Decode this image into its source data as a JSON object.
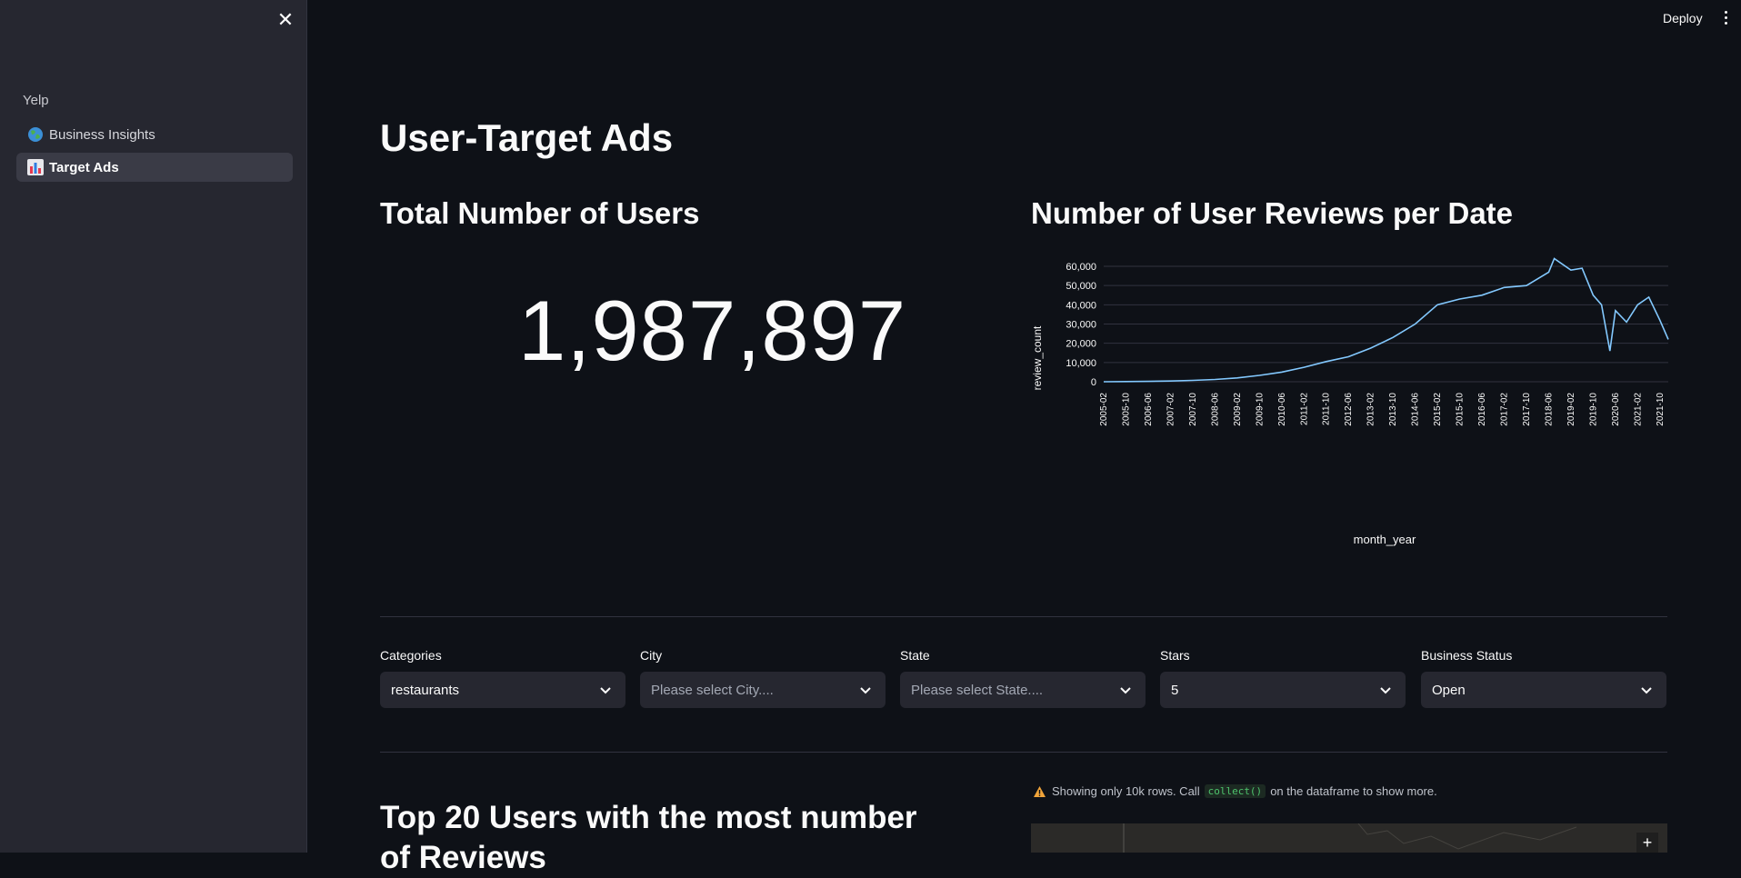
{
  "sidebar": {
    "section_title": "Yelp",
    "items": [
      {
        "label": "Business Insights",
        "icon": "globe-icon",
        "active": false
      },
      {
        "label": "Target Ads",
        "icon": "bar-chart-icon",
        "active": true
      }
    ]
  },
  "header": {
    "deploy_label": "Deploy"
  },
  "main": {
    "title": "User-Target Ads",
    "metric": {
      "title": "Total Number of Users",
      "value": "1,987,897"
    },
    "chart_title": "Number of User Reviews per Date",
    "filters": [
      {
        "label": "Categories",
        "value": "restaurants",
        "placeholder": false
      },
      {
        "label": "City",
        "value": "Please select City....",
        "placeholder": true
      },
      {
        "label": "State",
        "value": "Please select State....",
        "placeholder": true
      },
      {
        "label": "Stars",
        "value": "5",
        "placeholder": false
      },
      {
        "label": "Business Status",
        "value": "Open",
        "placeholder": false
      }
    ],
    "bottom_title": "Top 20 Users with the most number of Reviews",
    "warning": {
      "before": "Showing only 10k rows. Call",
      "code": "collect()",
      "after": "on the dataframe to show more."
    },
    "map_zoom_in": "+"
  },
  "colors": {
    "background": "#0e1117",
    "sidebar": "#262730",
    "line": "#83c9ff"
  },
  "chart_data": {
    "type": "line",
    "xlabel": "month_year",
    "ylabel": "review_count",
    "ylim": [
      0,
      60000
    ],
    "yticks": [
      "0",
      "10,000",
      "20,000",
      "30,000",
      "40,000",
      "50,000",
      "60,000"
    ],
    "xticks": [
      "2005-02",
      "2005-10",
      "2006-06",
      "2007-02",
      "2007-10",
      "2008-06",
      "2009-02",
      "2009-10",
      "2010-06",
      "2011-02",
      "2011-10",
      "2012-06",
      "2013-02",
      "2013-10",
      "2014-06",
      "2015-02",
      "2015-10",
      "2016-06",
      "2017-02",
      "2017-10",
      "2018-06",
      "2019-02",
      "2019-10",
      "2020-06",
      "2021-02",
      "2021-10"
    ],
    "x": [
      "2005-02",
      "2005-10",
      "2006-06",
      "2007-02",
      "2007-10",
      "2008-06",
      "2009-02",
      "2009-10",
      "2010-06",
      "2011-02",
      "2011-10",
      "2012-06",
      "2013-02",
      "2013-10",
      "2014-06",
      "2015-02",
      "2015-10",
      "2016-06",
      "2017-02",
      "2017-10",
      "2018-06",
      "2018-08",
      "2019-02",
      "2019-06",
      "2019-10",
      "2020-01",
      "2020-04",
      "2020-06",
      "2020-10",
      "2021-02",
      "2021-06",
      "2021-10",
      "2022-01"
    ],
    "series": [
      {
        "values": [
          0,
          100,
          200,
          400,
          700,
          1200,
          2000,
          3300,
          5000,
          7500,
          10500,
          13000,
          17500,
          23000,
          30000,
          40000,
          43000,
          45000,
          49000,
          50000,
          57000,
          64000,
          58000,
          59000,
          45000,
          40000,
          16000,
          37000,
          31000,
          40000,
          44000,
          32000,
          22000
        ]
      }
    ],
    "grid": true
  }
}
